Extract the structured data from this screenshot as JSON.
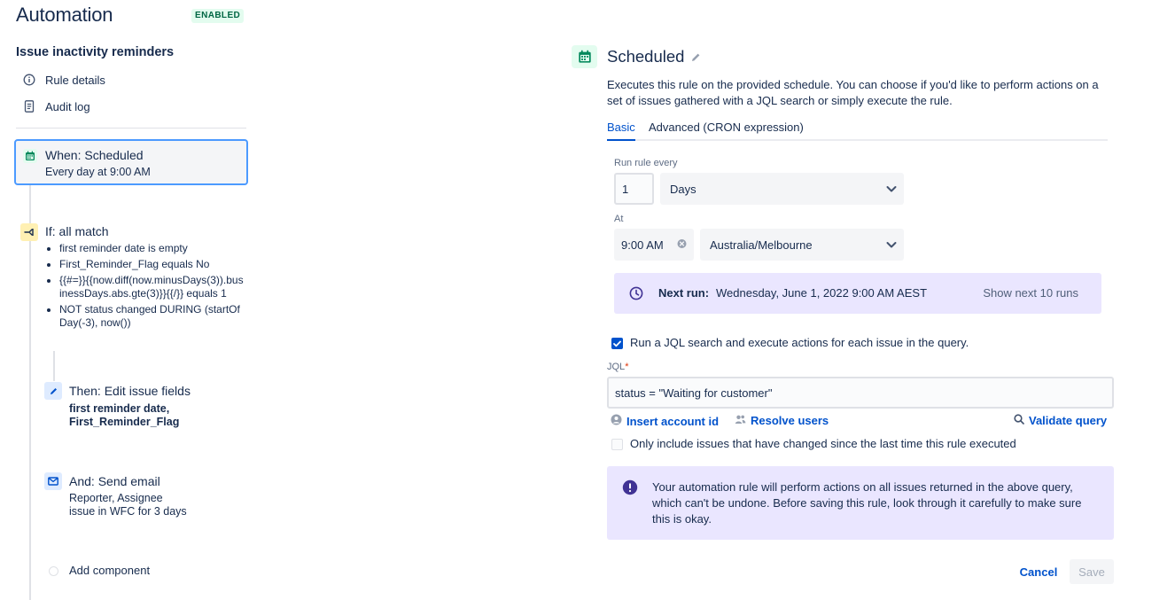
{
  "header": {
    "title": "Automation",
    "badge": "ENABLED"
  },
  "sidebar": {
    "rule_name": "Issue inactivity reminders",
    "nav": [
      {
        "label": "Rule details",
        "icon": "info-icon"
      },
      {
        "label": "Audit log",
        "icon": "document-icon"
      }
    ],
    "trigger": {
      "title": "When: Scheduled",
      "subtitle": "Every day at 9:00 AM",
      "icon": "calendar-icon"
    },
    "condition": {
      "title": "If: all match",
      "icon": "branch-icon",
      "items": [
        "first reminder date is empty",
        "First_Reminder_Flag equals No",
        "{{#=}}{{now.diff(now.minusDays(3)).businessDays.abs.gte(3)}}{{/}} equals 1",
        "NOT status changed DURING (startOfDay(-3), now())"
      ]
    },
    "actions": [
      {
        "title": "Then: Edit issue fields",
        "lines": [
          "first reminder date,",
          "First_Reminder_Flag"
        ],
        "bold": true,
        "icon": "pencil-icon"
      },
      {
        "title": "And: Send email",
        "lines": [
          "Reporter, Assignee",
          "issue in WFC for 3 days"
        ],
        "bold": false,
        "icon": "mail-icon"
      }
    ],
    "add_component": "Add component"
  },
  "panel": {
    "title": "Scheduled",
    "description": "Executes this rule on the provided schedule. You can choose if you'd like to perform actions on a set of issues gathered with a JQL search or simply execute the rule.",
    "tabs": [
      {
        "label": "Basic",
        "active": true
      },
      {
        "label": "Advanced (CRON expression)",
        "active": false
      }
    ],
    "run_every_label": "Run rule every",
    "run_every_value": "1",
    "run_every_unit": "Days",
    "at_label": "At",
    "time_value": "9:00 AM",
    "timezone": "Australia/Melbourne",
    "next_run_label": "Next run:",
    "next_run_value": "Wednesday, June 1, 2022 9:00 AM AEST",
    "show_next": "Show next 10 runs",
    "jql_checkbox_label": "Run a JQL search and execute actions for each issue in the query.",
    "jql_checkbox_checked": true,
    "jql_label": "JQL",
    "jql_required": "*",
    "jql_value": "status = \"Waiting for customer\"",
    "links": {
      "insert_account": "Insert account id",
      "resolve_users": "Resolve users",
      "validate": "Validate query"
    },
    "only_changed_label": "Only include issues that have changed since the last time this rule executed",
    "only_changed_checked": false,
    "warning": "Your automation rule will perform actions on all issues returned in the above query, which can't be undone. Before saving this rule, look through it carefully to make sure this is okay.",
    "cancel": "Cancel",
    "save": "Save"
  },
  "colors": {
    "accent": "#0052cc",
    "selected_border": "#4c9aff",
    "badge_bg": "#e3fcef",
    "badge_text": "#006644",
    "info_bg": "#eae6ff",
    "warning_icon": "#403294"
  }
}
